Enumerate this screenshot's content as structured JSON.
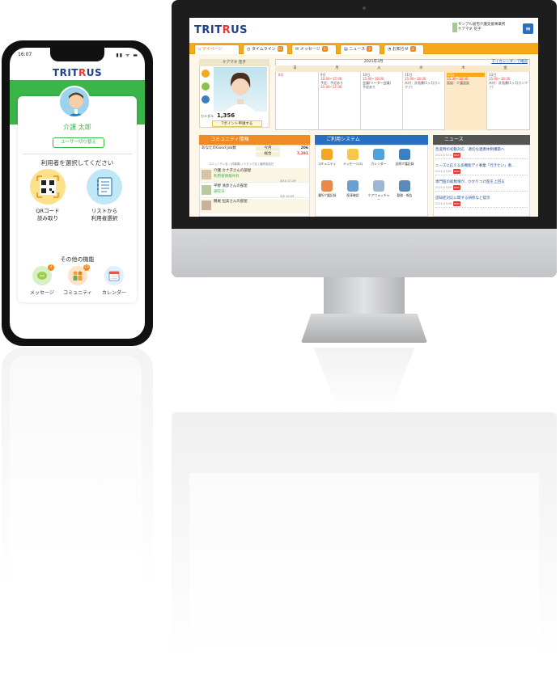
{
  "phone": {
    "time": "16:07",
    "status_icons": "▮▮ ᯤ ▬",
    "logo_a": "TRIT",
    "logo_b": "R",
    "logo_c": "US",
    "user_name": "介護 太郎",
    "switch_user_label": "ユーザー切り替え",
    "select_title": "利用者を選択してください",
    "qr_label_1": "QRコード",
    "qr_label_2": "読み取り",
    "list_label_1": "リストから",
    "list_label_2": "利用者選択",
    "other_title": "その他の機能",
    "functions": [
      {
        "label": "メッセージ",
        "badge": "3",
        "icon": "message-icon"
      },
      {
        "label": "コミュニティ",
        "badge": "15",
        "icon": "community-icon"
      },
      {
        "label": "カレンダー",
        "badge": "",
        "icon": "calendar-icon"
      }
    ]
  },
  "desktop": {
    "logo_a": "TRIT",
    "logo_b": "R",
    "logo_c": "US",
    "org_name": "サンプル居宅介護支援事業所",
    "user_name": "ケアマネ 花子",
    "menu_icon": "≡",
    "tabs": [
      {
        "label": "マイページ",
        "badge": ""
      },
      {
        "label": "タイムライン",
        "badge": "11"
      },
      {
        "label": "メッセージ",
        "badge": "3"
      },
      {
        "label": "ニュース",
        "badge": "2"
      },
      {
        "label": "お知らせ",
        "badge": "2"
      }
    ],
    "profile": {
      "title": "ケアマネ 花子",
      "points_label": "カメダル",
      "points": "1,356",
      "points_btn": "Tポイント申請する"
    },
    "calendar": {
      "month": "2021年3月",
      "link": "マイカレンダーで確認",
      "days": [
        "日",
        "月",
        "火",
        "水",
        "木",
        "金"
      ],
      "cells": [
        {
          "date": "8日",
          "l1": "",
          "l2": "",
          "l3": ""
        },
        {
          "date": "9日",
          "l1": "10:00~17:00",
          "l2": "予定：予定あり",
          "l3": "15:00~17:00"
        },
        {
          "date": "10日",
          "l1": "15:00~16:00",
          "l2": "会議(リーダー会議)",
          "l3": "予定あり"
        },
        {
          "date": "11日",
          "l1": "15:00~16:00",
          "l2": "木村：計画書(1ヶ月カンファ)",
          "l3": ""
        },
        {
          "date": "12日",
          "l1": "15:30~16:30",
          "l2": "面談：介護面談",
          "l3": ""
        },
        {
          "date": "13日",
          "l1": "15:00~16:00",
          "l2": "木村：計画書(1ヶ月カンファ)",
          "l3": ""
        }
      ]
    },
    "community": {
      "title": "コミュニティ情報",
      "good_job_label": "あなたのGood Job数",
      "today_label": "今月",
      "today_value": "206",
      "total_label": "総合",
      "total_value": "7,291",
      "filter": "コミュニティ名 / (件数順) / トピック名 / 最終返信日",
      "items": [
        {
          "name": "介護 カナ子さんの部屋",
          "sub": "利用者情報共有",
          "time": "3/10 17:29"
        },
        {
          "name": "平野 清彦さんの部屋",
          "sub": "通院日",
          "time": ""
        },
        {
          "name": "鶴尾 恒美さんの部屋",
          "sub": "",
          "time": "3/8 10:03"
        }
      ]
    },
    "system": {
      "title": "ご利用システム",
      "items": [
        {
          "label": "コミュニティ",
          "color": "#f5a623"
        },
        {
          "label": "メッセージ(3)",
          "color": "#f7c843"
        },
        {
          "label": "カレンダー",
          "color": "#4fa3d9"
        },
        {
          "label": "訪問介護記録",
          "color": "#3b7fc4"
        },
        {
          "label": "通所介護記録",
          "color": "#e8894a"
        },
        {
          "label": "配車確認",
          "color": "#6a9fd0"
        },
        {
          "label": "ケアウォッチャー",
          "color": "#9eb7d1"
        },
        {
          "label": "勤務・報告",
          "color": "#5c8ab8"
        }
      ]
    },
    "news": {
      "title": "ニュース",
      "items": [
        {
          "text": "急変時の初動対応　適切な連携体制構築へ",
          "date": "2021/03/10"
        },
        {
          "text": "ニーズに応える多機能デイ事業「行きたい」看…",
          "date": "2021/03/09"
        },
        {
          "text": "専門医の総数増が、かかりつけ医を上回る",
          "date": "2021/03/09"
        },
        {
          "text": "認知症対応に関する研修など提示",
          "date": "2021/03/08"
        }
      ],
      "new_tag": "NEW"
    }
  }
}
